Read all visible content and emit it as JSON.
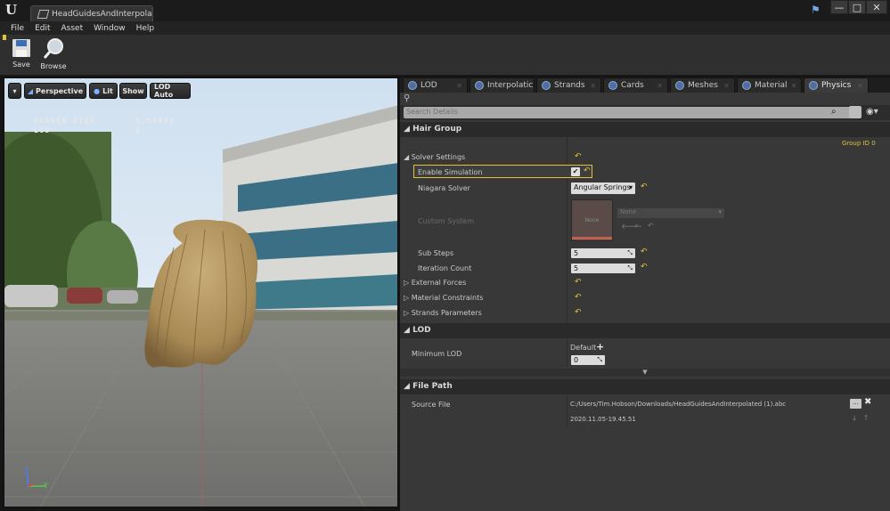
{
  "window": {
    "tab_title": "HeadGuidesAndInterpolat",
    "minimize": "—",
    "maximize": "□",
    "close": "✕"
  },
  "menu": [
    "File",
    "Edit",
    "Asset",
    "Window",
    "Help"
  ],
  "toolbar": {
    "save_label": "Save",
    "browse_label": "Browse"
  },
  "viewport": {
    "perspective_label": "Perspective",
    "lit_label": "Lit",
    "show_label": "Show",
    "lod_auto_label": "LOD Auto",
    "screen_size_label": "SCREEN SIZE",
    "screen_size_value": "0.53482",
    "lod_label": "LOD",
    "lod_value": "0.",
    "axis_z": "Z",
    "axis_y": "Y"
  },
  "details": {
    "tabs": [
      "LOD",
      "Interpolatic",
      "Strands",
      "Cards",
      "Meshes",
      "Material",
      "Physics"
    ],
    "active_tab": "Physics",
    "search_placeholder": "Search Details",
    "hair_group": {
      "header": "Hair Group",
      "group_id": "Group ID 0",
      "solver_settings": "Solver Settings",
      "enable_simulation": "Enable Simulation",
      "enable_simulation_checked": true,
      "niagara_solver_label": "Niagara Solver",
      "niagara_solver_value": "Angular Springs",
      "custom_system_label": "Custom System",
      "custom_system_thumb": "None",
      "custom_system_value": "None",
      "sub_steps_label": "Sub Steps",
      "sub_steps_value": "5",
      "iteration_count_label": "Iteration Count",
      "iteration_count_value": "5",
      "external_forces": "External Forces",
      "material_constraints": "Material Constraints",
      "strands_parameters": "Strands Parameters"
    },
    "lod": {
      "header": "LOD",
      "minimum_lod_label": "Minimum LOD",
      "default_label": "Default",
      "minimum_lod_value": "0"
    },
    "file_path": {
      "header": "File Path",
      "source_file_label": "Source File",
      "source_file_path": "C:/Users/Tim.Hobson/Downloads/HeadGuidesAndInterpolated (1).abc",
      "timestamp": "2020.11.05-19.45.51"
    }
  },
  "colors": {
    "accent_yellow": "#e0c33a",
    "tab_bar": "#1d1d1d",
    "panel": "#383838"
  }
}
